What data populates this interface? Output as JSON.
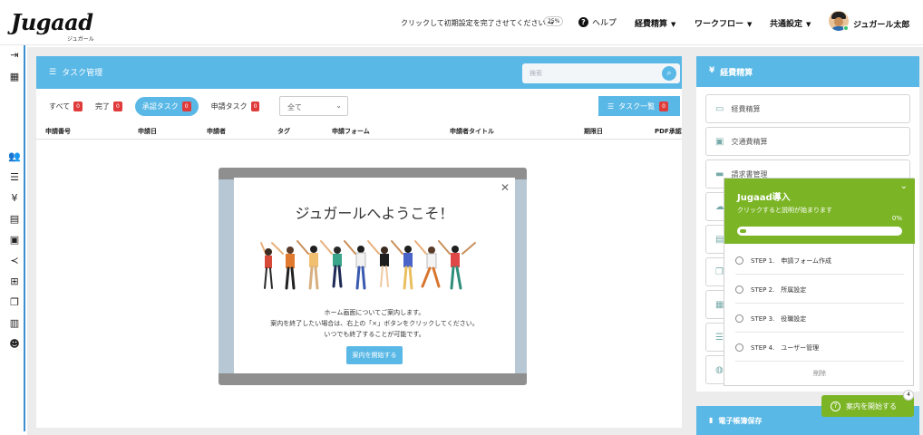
{
  "header": {
    "logo": "Jugaad",
    "logo_sub": "ジュガール",
    "setup_prompt": "クリックして初期設定を完了させてください →",
    "setup_progress": "25%",
    "help": "ヘルプ",
    "menus": [
      "経費精算",
      "ワークフロー",
      "共通設定"
    ],
    "user_name": "ジュガール太郎"
  },
  "task_panel": {
    "title": "タスク管理",
    "search_placeholder": "検索",
    "tabs": [
      {
        "label": "すべて",
        "count": "0"
      },
      {
        "label": "完了",
        "count": "0"
      },
      {
        "label": "承認タスク",
        "count": "0"
      },
      {
        "label": "申請タスク",
        "count": "0"
      }
    ],
    "filter_value": "全て",
    "task_list_button": "タスク一覧",
    "task_list_count": "0",
    "columns": [
      "申請番号",
      "申請日",
      "申請者",
      "タグ",
      "申請フォーム",
      "申請者タイトル",
      "期限日",
      "PDF承認"
    ]
  },
  "expense_panel": {
    "title": "経費精算",
    "items": [
      "経費精算",
      "交通費精算",
      "請求書管理"
    ]
  },
  "ebook_panel": {
    "title": "電子帳簿保存"
  },
  "guide": {
    "title": "Jugaad導入",
    "subtitle": "クリックすると説明が始まります",
    "percent": "0%",
    "progress": 0.04,
    "steps": [
      "STEP 1.　申請フォーム作成",
      "STEP 2.　所属設定",
      "STEP 3.　役職設定",
      "STEP 4.　ユーザー管理"
    ],
    "delete_label": "削除"
  },
  "start_button": {
    "label": "案内を開始する",
    "badge": "4"
  },
  "modal": {
    "title": "ジュガールへようこそ！",
    "lines": [
      "ホーム画面についてご案内します。",
      "案内を終了したい場合は、右上の「×」ボタンをクリックしてください。",
      "いつでも終了することが可能です。"
    ],
    "button": "案内を開始する"
  },
  "colors": {
    "accent_blue": "#5ab8e6",
    "guide_green": "#7bb526",
    "badge_red": "#e03b3b"
  }
}
